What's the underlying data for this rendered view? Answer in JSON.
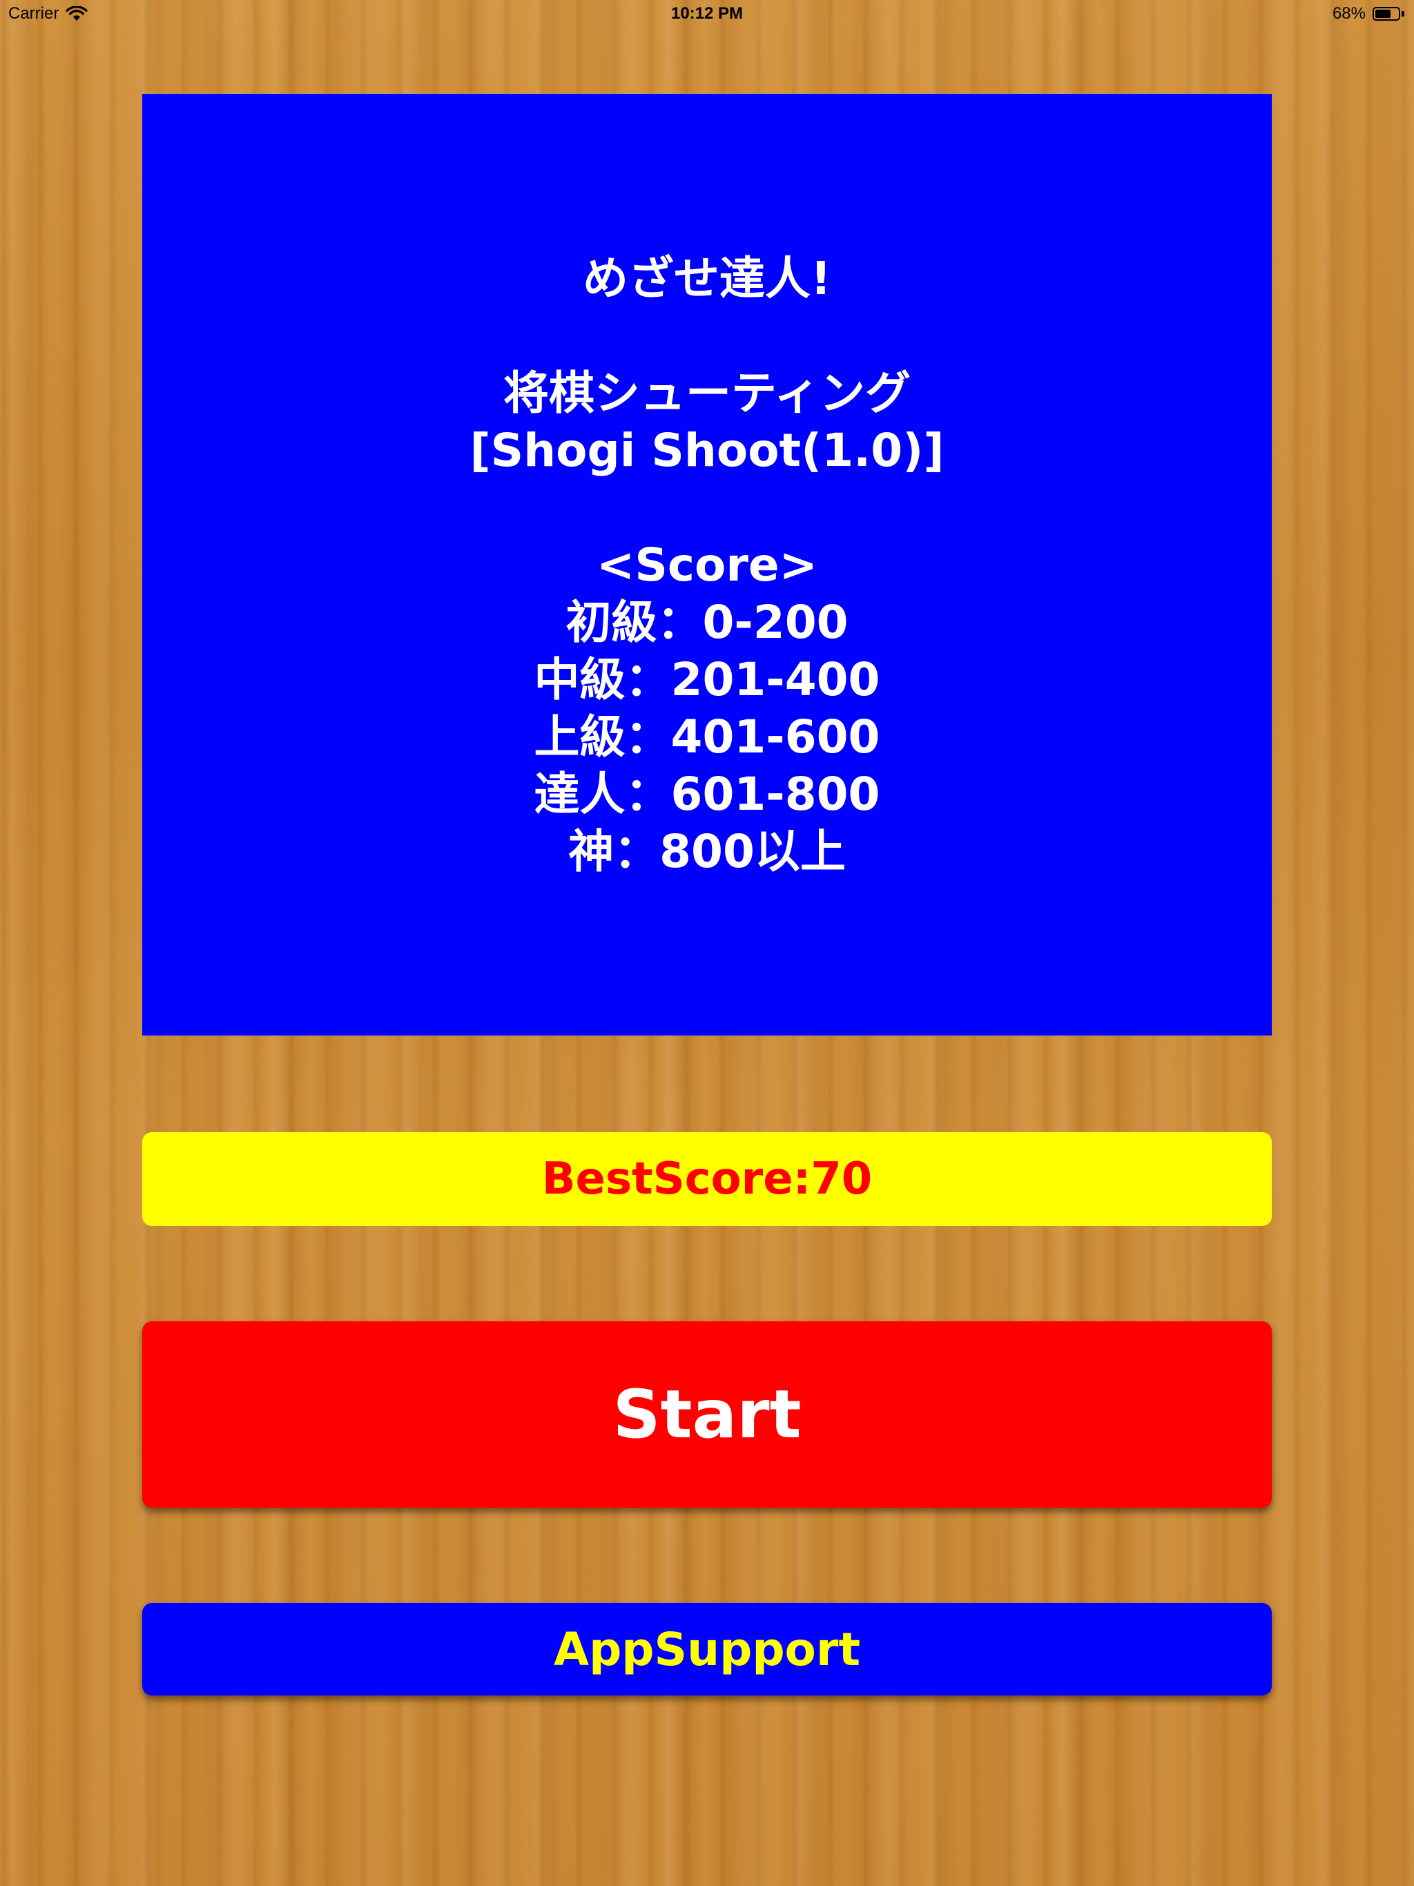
{
  "status_bar": {
    "carrier": "Carrier",
    "time": "10:12 PM",
    "battery": "68%",
    "battery_level": 0.68,
    "icons": [
      "wifi-icon",
      "battery-icon"
    ]
  },
  "info_panel": {
    "tagline": "めざせ達人!",
    "title_jp": "将棋シューティング",
    "title_en": "[Shogi Shoot(1.0)]",
    "score_heading": "<Score>",
    "ranks": [
      "初級：0-200",
      "中級：201-400",
      "上級：401-600",
      "達人：601-800",
      "神：800以上"
    ]
  },
  "best_score": {
    "label": "BestScore:70"
  },
  "buttons": {
    "start": "Start",
    "app_support": "AppSupport"
  },
  "colors": {
    "panel_blue": "#0000ff",
    "best_score_bg": "#ffff00",
    "best_score_text": "#ff0000",
    "start_bg": "#ff0000",
    "support_text": "#ffff00",
    "wood": "#c98a35"
  }
}
